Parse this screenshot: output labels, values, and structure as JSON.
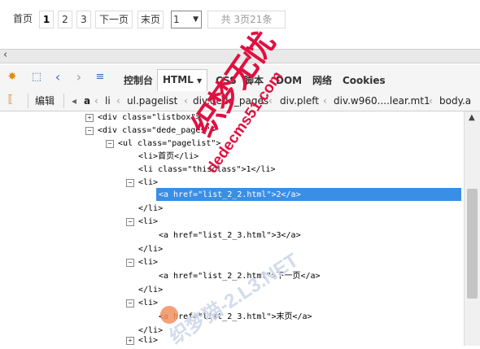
{
  "pagination": {
    "first": "首页",
    "pages": [
      "1",
      "2",
      "3"
    ],
    "next": "下一页",
    "last": "末页",
    "select_value": "1",
    "info": "共 3页21条"
  },
  "toolbar": {
    "tabs": [
      "控制台",
      "HTML",
      "CSS",
      "脚本",
      "DOM",
      "网络",
      "Cookies"
    ],
    "active_tab": "HTML"
  },
  "breadcrumb": {
    "edit_label": "编辑",
    "items": [
      "a",
      "li",
      "ul.pagelist",
      "div.dede_pages",
      "div.pleft",
      "div.w960....lear.mt1",
      "body.a"
    ]
  },
  "tree": {
    "rows": [
      {
        "indent": 0,
        "text": "<div  class=\"listbox\">"
      },
      {
        "indent": 0,
        "text": "<div  class=\"dede_pages\">"
      },
      {
        "indent": 1,
        "text": "<ul  class=\"pagelist\">"
      },
      {
        "indent": 2,
        "text": "<li>首页</li>"
      },
      {
        "indent": 2,
        "text": "<li  class=\"thisclass\">1</li>"
      },
      {
        "indent": 2,
        "text": "<li>"
      },
      {
        "indent": 3,
        "text": "<a  href=\"list_2_2.html\">2</a>"
      },
      {
        "indent": 2,
        "text": "</li>"
      },
      {
        "indent": 2,
        "text": "<li>"
      },
      {
        "indent": 3,
        "text": "<a  href=\"list_2_3.html\">3</a>"
      },
      {
        "indent": 2,
        "text": "</li>"
      },
      {
        "indent": 2,
        "text": "<li>"
      },
      {
        "indent": 3,
        "text": "<a  href=\"list_2_2.html\">下一页</a>"
      },
      {
        "indent": 2,
        "text": "</li>"
      },
      {
        "indent": 2,
        "text": "<li>"
      },
      {
        "indent": 3,
        "text": "<a  href=\"list_2_3.html\">末页</a>"
      },
      {
        "indent": 2,
        "text": "</li>"
      },
      {
        "indent": 2,
        "text": "<li>"
      }
    ]
  },
  "watermark": {
    "brand": "织梦无忧",
    "site1": "dedecms51.com",
    "site2": "织梦猫-2.L3.NET"
  }
}
